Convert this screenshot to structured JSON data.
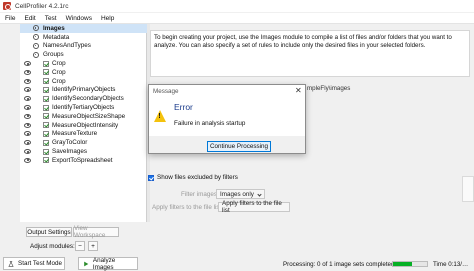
{
  "window": {
    "title": "CellProfiler 4.2.1rc"
  },
  "menu": [
    "File",
    "Edit",
    "Test",
    "Windows",
    "Help"
  ],
  "pipeline": {
    "input_modules": [
      "Images",
      "Metadata",
      "NamesAndTypes",
      "Groups"
    ],
    "modules": [
      "Crop",
      "Crop",
      "Crop",
      "IdentifyPrimaryObjects",
      "IdentifySecondaryObjects",
      "IdentifyTertiaryObjects",
      "MeasureObjectSizeShape",
      "MeasureObjectIntensity",
      "MeasureTexture",
      "GrayToColor",
      "SaveImages",
      "ExportToSpreadsheet"
    ]
  },
  "panel": {
    "output_settings_label": "Output Settings",
    "view_workspace_label": "View Workspace",
    "adjust_modules_label": "Adjust modules:",
    "remove_symbol": "−",
    "add_symbol": "+",
    "start_test_label": "Start Test Mode",
    "analyze_label": "Analyze Images"
  },
  "module_info": {
    "text": "To begin creating your project, use the Images module to compile a list of files and/or folders that you want to analyze. You can also specify a set of rules to include only the desired files in your selected folders."
  },
  "file_list": {
    "path_fragment": "mpleFly\\images"
  },
  "filters": {
    "show_excluded_label": "Show files excluded by filters",
    "filter_images_label": "Filter images?",
    "filter_images_value": "Images only",
    "apply_filters_label": "Apply filters to the file list",
    "apply_filters_button": "Apply filters to the file list"
  },
  "status": {
    "processing_text": "Processing: 0 of 1 image sets completed",
    "progress": 0.55,
    "time_text": "Time 0:13/…"
  },
  "dialog": {
    "title": "Message",
    "close_symbol": "✕",
    "heading": "Error",
    "message": "Failure in analysis startup",
    "button_label": "Continue Processing"
  },
  "colors": {
    "accent": "#0078d7",
    "selection": "#cfe3f7",
    "progress_green": "#06b025",
    "warning_yellow": "#f4c20d"
  }
}
